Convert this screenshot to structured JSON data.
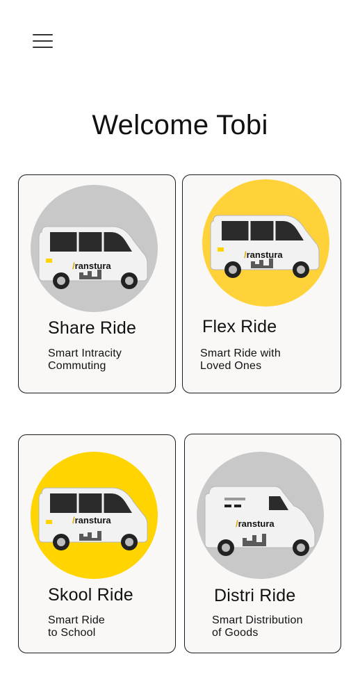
{
  "header": {
    "menu_icon": "hamburger-menu-icon",
    "welcome": "Welcome Tobi"
  },
  "cards": [
    {
      "title": "Share Ride",
      "subtitle": "Smart Intracity\nCommuting",
      "circle_color": "#c8c8c8",
      "brand": "ranstura"
    },
    {
      "title": "Flex Ride",
      "subtitle": "Smart Ride with\nLoved Ones",
      "circle_color": "#ffd23a",
      "brand": "ranstura"
    },
    {
      "title": "Skool Ride",
      "subtitle": "Smart Ride\nto School",
      "circle_color": "#ffd400",
      "brand": "ranstura"
    },
    {
      "title": "Distri Ride",
      "subtitle": "Smart Distribution\nof Goods",
      "circle_color": "#c8c8c8",
      "brand": "ranstura"
    }
  ],
  "colors": {
    "background": "#ffffff",
    "card_background": "#f9f8f6",
    "card_border": "#1a1a1a",
    "brand_yellow": "#ffd400",
    "neutral_gray": "#c8c8c8"
  }
}
